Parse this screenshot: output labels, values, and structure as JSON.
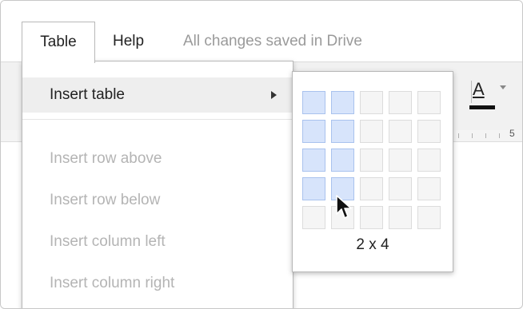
{
  "menubar": {
    "active_menu": "Table",
    "help_label": "Help",
    "save_status": "All changes saved in Drive"
  },
  "toolbar": {
    "text_color_label": "A",
    "ruler_number": "5"
  },
  "table_menu": {
    "items": [
      {
        "label": "Insert table",
        "enabled": true,
        "has_submenu": true
      },
      {
        "label": "Insert row above",
        "enabled": false
      },
      {
        "label": "Insert row below",
        "enabled": false
      },
      {
        "label": "Insert column left",
        "enabled": false
      },
      {
        "label": "Insert column right",
        "enabled": false
      }
    ]
  },
  "table_picker": {
    "columns": 5,
    "rows": 5,
    "selected_columns": 2,
    "selected_rows": 4,
    "size_label": "2 x 4"
  },
  "colors": {
    "selected_cell": "#d7e4fb",
    "hover_item": "#eeeeee",
    "disabled_text": "#b4b4b4"
  }
}
